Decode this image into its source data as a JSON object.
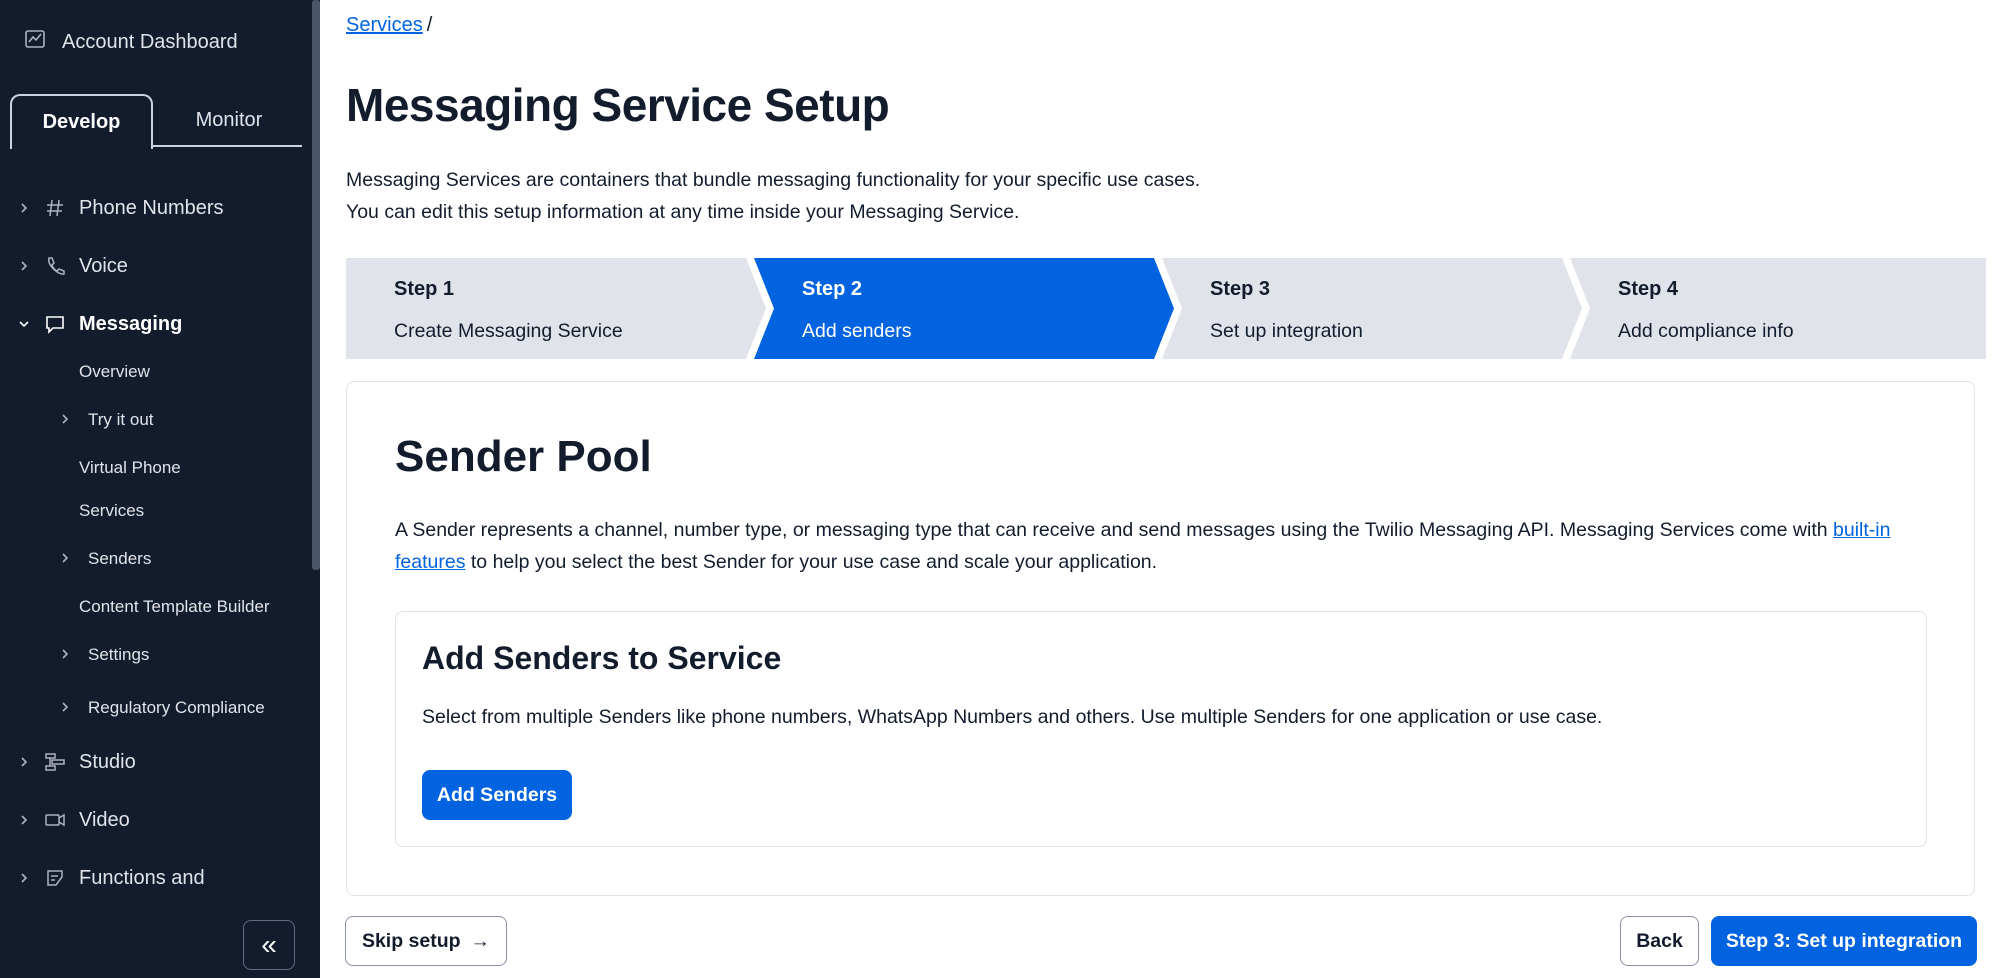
{
  "sidebar": {
    "account_dashboard": "Account Dashboard",
    "tabs": [
      {
        "label": "Develop",
        "active": true
      },
      {
        "label": "Monitor",
        "active": false
      }
    ],
    "nav": [
      {
        "label": "Phone Numbers",
        "icon": "hash-icon",
        "expanded": false
      },
      {
        "label": "Voice",
        "icon": "phone-icon",
        "expanded": false
      },
      {
        "label": "Messaging",
        "icon": "chat-bubble-icon",
        "expanded": true
      },
      {
        "label": "Studio",
        "icon": "flow-icon",
        "expanded": false
      },
      {
        "label": "Video",
        "icon": "video-icon",
        "expanded": false
      },
      {
        "label": "Functions and",
        "icon": "functions-icon",
        "expanded": false
      }
    ],
    "messaging_sub": [
      {
        "label": "Overview",
        "chevron": false
      },
      {
        "label": "Try it out",
        "chevron": true
      },
      {
        "label": "Virtual Phone",
        "chevron": false
      },
      {
        "label": "Services",
        "chevron": false
      },
      {
        "label": "Senders",
        "chevron": true
      },
      {
        "label": "Content Template Builder",
        "chevron": false
      },
      {
        "label": "Settings",
        "chevron": true
      },
      {
        "label": "Regulatory Compliance",
        "chevron": true
      }
    ],
    "collapse_glyph": "«"
  },
  "main": {
    "breadcrumb": {
      "link": "Services",
      "separator": "/"
    },
    "title": "Messaging Service Setup",
    "intro": [
      "Messaging Services are containers that bundle messaging functionality for your specific use cases.",
      "You can edit this setup information at any time inside your Messaging Service."
    ],
    "steps": [
      {
        "title": "Step 1",
        "subtitle": "Create Messaging Service",
        "active": false
      },
      {
        "title": "Step 2",
        "subtitle": "Add senders",
        "active": true
      },
      {
        "title": "Step 3",
        "subtitle": "Set up integration",
        "active": false
      },
      {
        "title": "Step 4",
        "subtitle": "Add compliance info",
        "active": false
      }
    ],
    "sender_pool": {
      "title": "Sender Pool",
      "desc_before": "A Sender represents a channel, number type, or messaging type that can receive and send messages using the Twilio Messaging API. Messaging Services come with ",
      "desc_link": "built-in features",
      "desc_after": " to help you select the best Sender for your use case and scale your application.",
      "add_card": {
        "title": "Add Senders to Service",
        "desc": "Select from multiple Senders like phone numbers, WhatsApp Numbers and others. Use multiple Senders for one application or use case.",
        "button": "Add Senders"
      }
    },
    "footer": {
      "skip": "Skip setup",
      "skip_arrow": "→",
      "back": "Back",
      "next": "Step 3: Set up integration"
    }
  },
  "colors": {
    "sidebar_bg": "#121c2d",
    "accent": "#0263e0",
    "step_inactive": "#e1e3ea",
    "text": "#121c2d"
  }
}
